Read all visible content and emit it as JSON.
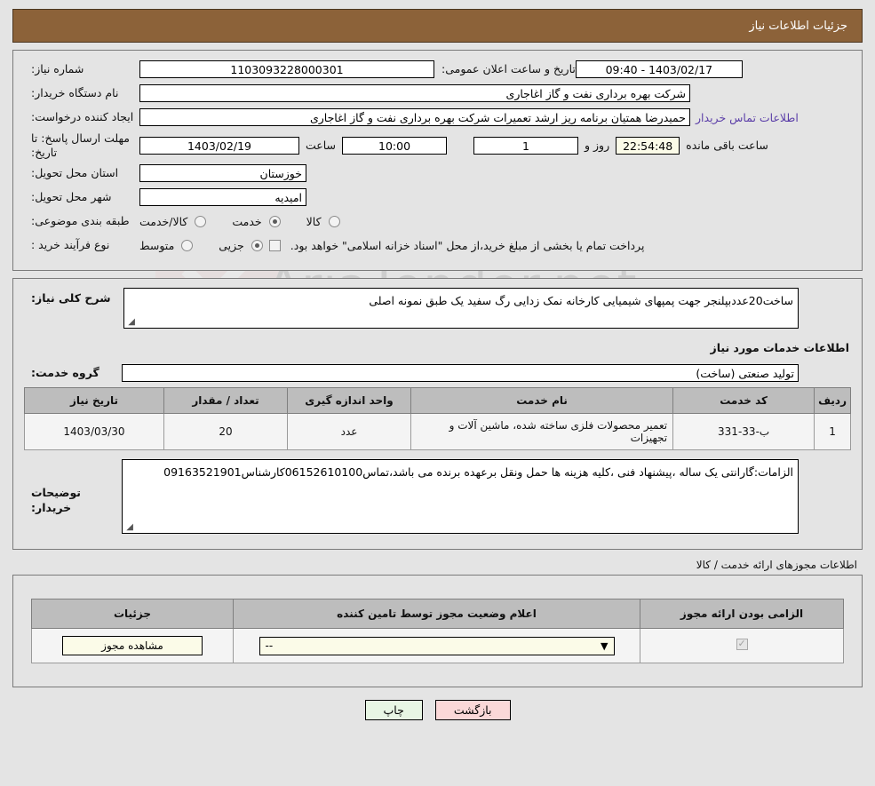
{
  "window": {
    "title": "جزئیات اطلاعات نیاز"
  },
  "form": {
    "need_number_label": "شماره نیاز:",
    "need_number_value": "1103093228000301",
    "public_announce_label": "تاریخ و ساعت اعلان عمومی:",
    "public_announce_value": "1403/02/17 - 09:40",
    "buyer_org_label": "نام دستگاه خریدار:",
    "buyer_org_value": "شرکت بهره برداری نفت و گاز اغاجاری",
    "creator_label": "ایجاد کننده درخواست:",
    "creator_value": "حمیدرضا همتیان برنامه ریز ارشد تعمیرات شرکت بهره برداری نفت و گاز اغاجاری",
    "buyer_contact_link": "اطلاعات تماس خریدار",
    "deadline_label": "مهلت ارسال پاسخ: تا تاریخ:",
    "deadline_date": "1403/02/19",
    "hour_label": "ساعت",
    "deadline_time": "10:00",
    "days_value": "1",
    "days_label": "روز و",
    "remaining_time": "22:54:48",
    "remaining_label": "ساعت باقی مانده",
    "province_label": "استان محل تحویل:",
    "province_value": "خوزستان",
    "city_label": "شهر محل تحویل:",
    "city_value": "امیدیه",
    "category_label": "طبقه بندی موضوعی:",
    "category_options": [
      {
        "label": "کالا",
        "selected": false
      },
      {
        "label": "خدمت",
        "selected": true
      },
      {
        "label": "کالا/خدمت",
        "selected": false
      }
    ],
    "process_label": "نوع فرآیند خرید :",
    "process_options": [
      {
        "label": "جزیی",
        "selected": true
      },
      {
        "label": "متوسط",
        "selected": false
      }
    ],
    "treasury_checked": false,
    "treasury_text": "پرداخت تمام یا بخشی از مبلغ خرید،از محل \"اسناد خزانه اسلامی\" خواهد بود."
  },
  "description": {
    "label": "شرح کلی نیاز:",
    "value": "ساخت20عددبپلنجر جهت پمپهای شیمیایی کارخانه نمک زدایی رگ سفید یک طبق نمونه اصلی"
  },
  "services": {
    "section_title": "اطلاعات خدمات مورد نیاز",
    "group_label": "گروه خدمت:",
    "group_value": "تولید صنعتی (ساخت)",
    "columns": [
      "ردیف",
      "کد خدمت",
      "نام خدمت",
      "واحد اندازه گیری",
      "تعداد / مقدار",
      "تاریخ نیاز"
    ],
    "rows": [
      {
        "row": "1",
        "code": "ب-33-331",
        "name": "تعمیر محصولات فلزی ساخته شده، ماشین آلات و تجهیزات",
        "unit": "عدد",
        "qty": "20",
        "date": "1403/03/30"
      }
    ]
  },
  "buyer_notes": {
    "label": "توضیحات خریدار:",
    "value": "الزامات:گارانتی یک ساله ،پیشنهاد فنی ،کلیه هزینه ها حمل ونقل برعهده برنده می باشد،تماس06152610100کارشناس09163521901"
  },
  "permits": {
    "caption": "اطلاعات مجوزهای ارائه خدمت / کالا",
    "columns": [
      "الزامی بودن ارائه مجوز",
      "اعلام وضعیت مجوز توسط تامین کننده",
      "جزئیات"
    ],
    "rows": [
      {
        "required": true,
        "status_selected": "--",
        "details_button": "مشاهده مجوز"
      }
    ]
  },
  "footer": {
    "print_label": "چاپ",
    "back_label": "بازگشت"
  },
  "watermark": {
    "text": "AriaTender.net"
  },
  "colors": {
    "titlebar": "#8c6239",
    "link": "#5b3ea8",
    "table_header": "#bdbdbd",
    "print_button": "#e8f6e4",
    "back_button": "#fbd8d8",
    "field_highlight": "#fbfbe8"
  }
}
